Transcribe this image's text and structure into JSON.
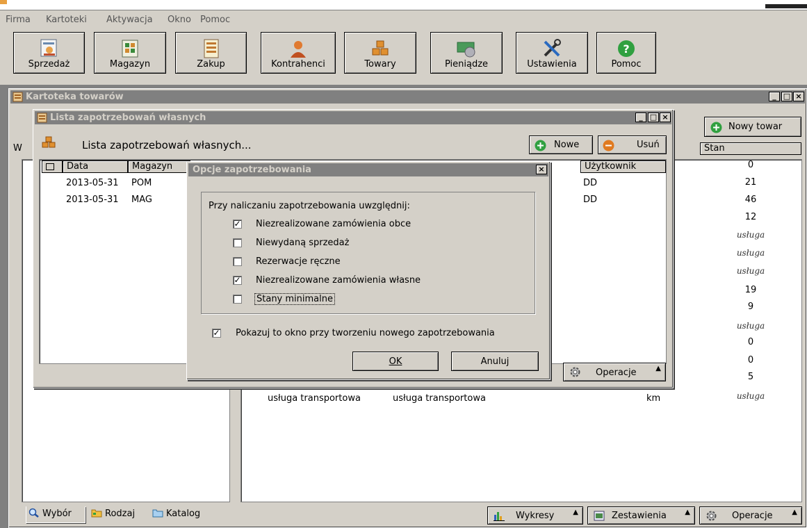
{
  "menu": [
    "Firma",
    "Kartoteki",
    "Aktywacja",
    "Okno",
    "Pomoc"
  ],
  "toolbar": [
    {
      "label": "Sprzedaż",
      "icon": "sales-icon"
    },
    {
      "label": "Magazyn",
      "icon": "warehouse-icon"
    },
    {
      "label": "Zakup",
      "icon": "purchase-icon"
    },
    {
      "label": "Kontrahenci",
      "icon": "contractors-icon"
    },
    {
      "label": "Towary",
      "icon": "goods-icon"
    },
    {
      "label": "Pieniądze",
      "icon": "money-icon"
    },
    {
      "label": "Ustawienia",
      "icon": "settings-icon"
    },
    {
      "label": "Pomoc",
      "icon": "help-icon"
    }
  ],
  "kartoteka": {
    "title": "Kartoteka towarów",
    "new_button": "Nowy towar",
    "col_left_letter": "W",
    "col_stan": "Stan",
    "stan_values": [
      "0",
      "21",
      "46",
      "12",
      "usługa",
      "usługa",
      "usługa",
      "19",
      "9",
      "usługa",
      "0",
      "0",
      "5",
      "usługa"
    ],
    "visible_row": {
      "name": "usługa transportowa",
      "name2": "usługa transportowa",
      "unit": "km"
    },
    "bottom_tabs": [
      "Wybór",
      "Rodzaj",
      "Katalog"
    ],
    "bottom_buttons": [
      "Wykresy",
      "Zestawienia",
      "Operacje"
    ]
  },
  "lista": {
    "title": "Lista zapotrzebowań własnych",
    "heading": "Lista zapotrzebowań własnych...",
    "btn_new": "Nowe",
    "btn_delete": "Usuń",
    "columns": [
      "Data",
      "Magazyn",
      "Użytkownik"
    ],
    "rows": [
      {
        "date": "2013-05-31",
        "mag": "POM",
        "user": "DD"
      },
      {
        "date": "2013-05-31",
        "mag": "MAG",
        "user": "DD"
      }
    ],
    "operacje": "Operacje"
  },
  "opcje": {
    "title": "Opcje zapotrzebowania",
    "group_label": "Przy naliczaniu zapotrzebowania uwzględnij:",
    "options": [
      {
        "label": "Niezrealizowane zamówienia obce",
        "checked": true
      },
      {
        "label": "Niewydaną sprzedaż",
        "checked": false
      },
      {
        "label": "Rezerwacje ręczne",
        "checked": false
      },
      {
        "label": "Niezrealizowane zamówienia własne",
        "checked": true
      },
      {
        "label": "Stany minimalne",
        "checked": false
      }
    ],
    "show_window": {
      "label": "Pokazuj to okno przy tworzeniu nowego zapotrzebowania",
      "checked": true
    },
    "ok": "OK",
    "cancel": "Anuluj"
  }
}
